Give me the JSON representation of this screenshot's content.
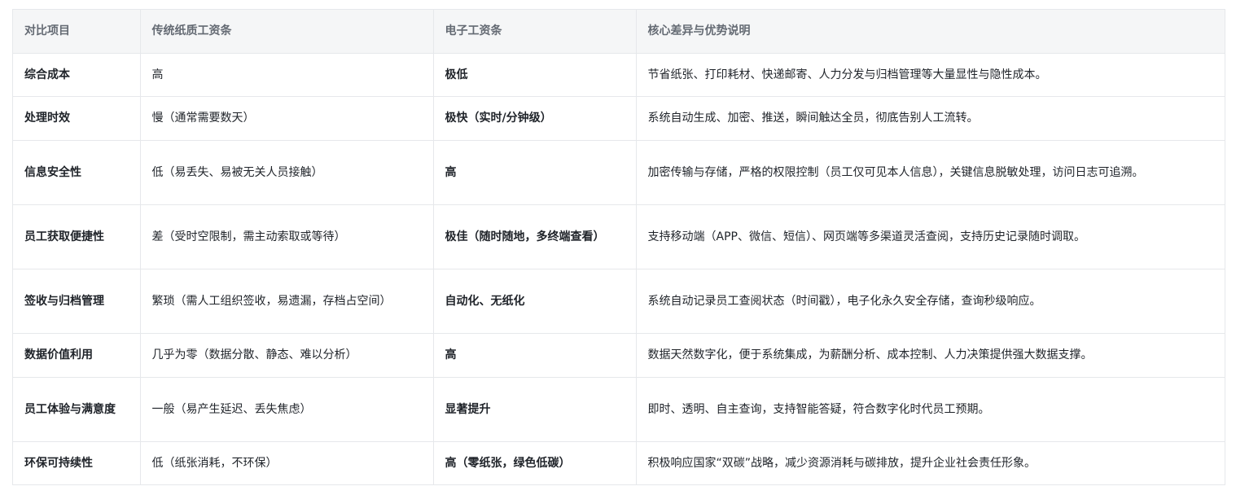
{
  "table": {
    "headers": [
      "对比项目",
      "传统纸质工资条",
      "电子工资条",
      "核心差异与优势说明"
    ],
    "rows": [
      {
        "item": "综合成本",
        "paper": "高",
        "digital": "极低",
        "note": "节省纸张、打印耗材、快递邮寄、人力分发与归档管理等大量显性与隐性成本。"
      },
      {
        "item": "处理时效",
        "paper": "慢（通常需要数天）",
        "digital": "极快（实时/分钟级）",
        "note": "系统自动生成、加密、推送，瞬间触达全员，彻底告别人工流转。"
      },
      {
        "item": "信息安全性",
        "paper": "低（易丢失、易被无关人员接触）",
        "digital": "高",
        "note": "加密传输与存储，严格的权限控制（员工仅可见本人信息），关键信息脱敏处理，访问日志可追溯。"
      },
      {
        "item": "员工获取便捷性",
        "paper": "差（受时空限制，需主动索取或等待）",
        "digital": "极佳（随时随地，多终端查看）",
        "note": "支持移动端（APP、微信、短信）、网页端等多渠道灵活查阅，支持历史记录随时调取。"
      },
      {
        "item": "签收与归档管理",
        "paper": "繁琐（需人工组织签收，易遗漏，存档占空间）",
        "digital": "自动化、无纸化",
        "note": "系统自动记录员工查阅状态（时间戳），电子化永久安全存储，查询秒级响应。"
      },
      {
        "item": "数据价值利用",
        "paper": "几乎为零（数据分散、静态、难以分析）",
        "digital": "高",
        "note": "数据天然数字化，便于系统集成，为薪酬分析、成本控制、人力决策提供强大数据支撑。"
      },
      {
        "item": "员工体验与满意度",
        "paper": "一般（易产生延迟、丢失焦虑）",
        "digital": "显著提升",
        "note": "即时、透明、自主查询，支持智能答疑，符合数字化时代员工预期。"
      },
      {
        "item": "环保可持续性",
        "paper": "低（纸张消耗，不环保）",
        "digital": "高（零纸张，绿色低碳）",
        "note": "积极响应国家“双碳”战略，减少资源消耗与碳排放，提升企业社会责任形象。"
      }
    ]
  }
}
